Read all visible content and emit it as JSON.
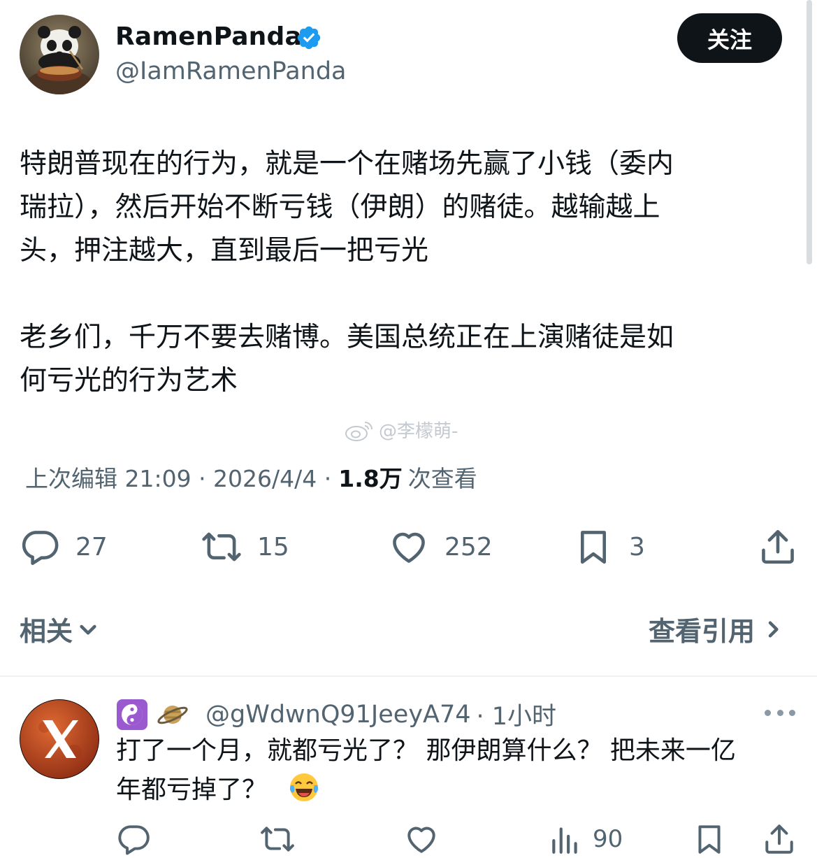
{
  "author": {
    "display_name": "RamenPanda",
    "handle": "@IamRamenPanda",
    "verified_icon": "verified-badge-icon",
    "follow_label": "关注"
  },
  "tweet": {
    "text": "特朗普现在的行为，就是一个在赌场先赢了小钱（委内\n瑞拉），然后开始不断亏钱（伊朗）的赌徒。越输越上\n头，押注越大，直到最后一把亏光\n\n老乡们，千万不要去赌博。美国总统正在上演赌徒是如\n何亏光的行为艺术",
    "watermark": "@李檬萌-",
    "meta_prefix": "上次编辑 21:09 · 2026/4/4 ·",
    "views_count": "1.8万",
    "views_label": "次查看"
  },
  "actions": {
    "replies": "27",
    "retweets": "15",
    "likes": "252",
    "bookmarks": "3"
  },
  "related_label": "相关",
  "quotes_label": "查看引用",
  "reply": {
    "handle": "@gWdwnQ91JeeyA74",
    "time": "· 1小时",
    "emojis": [
      "yin-yang-icon",
      "ringed-planet-icon"
    ],
    "text": "打了一个月，就都亏光了？ 那伊朗算什么？ 把未来一亿\n年都亏掉了？",
    "laugh_icon": "face-with-tears-of-joy-icon",
    "views": "90"
  },
  "colors": {
    "text": "#0f1419",
    "secondary": "#536471",
    "follow_bg": "#0f1419",
    "verified": "#1d9bf0"
  }
}
